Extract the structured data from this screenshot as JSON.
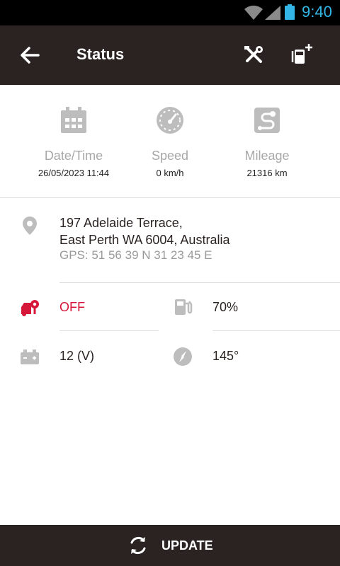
{
  "status_bar": {
    "time": "9:40",
    "time_color": "#33b5e5"
  },
  "toolbar": {
    "title": "Status",
    "back_icon": "arrow-left-icon",
    "tools_icon": "wrench-screwdriver-icon",
    "fuel_icon": "fuel-add-icon"
  },
  "stats": {
    "datetime": {
      "label": "Date/Time",
      "value": "26/05/2023 11:44",
      "icon": "calendar-icon"
    },
    "speed": {
      "label": "Speed",
      "value": "0 km/h",
      "icon": "speedometer-icon"
    },
    "mileage": {
      "label": "Mileage",
      "value": "21316 km",
      "icon": "route-icon"
    }
  },
  "location": {
    "line1": "197 Adelaide Terrace,",
    "line2": "East Perth WA 6004, Australia",
    "gps": "GPS: 51 56 39 N 31 23 45 E",
    "icon": "location-pin-icon"
  },
  "details": {
    "ignition": {
      "value": "OFF",
      "icon": "car-ignition-icon",
      "color": "#d7173a"
    },
    "fuel": {
      "value": "70%",
      "icon": "fuel-pump-icon"
    },
    "battery": {
      "value": "12 (V)",
      "icon": "battery-icon"
    },
    "heading": {
      "value": "145°",
      "icon": "compass-icon"
    }
  },
  "bottom": {
    "update_label": "UPDATE",
    "icon": "refresh-icon"
  },
  "colors": {
    "toolbar": "#2a2322",
    "accent_red": "#d7173a",
    "icon_grey": "#bdbdbd"
  }
}
